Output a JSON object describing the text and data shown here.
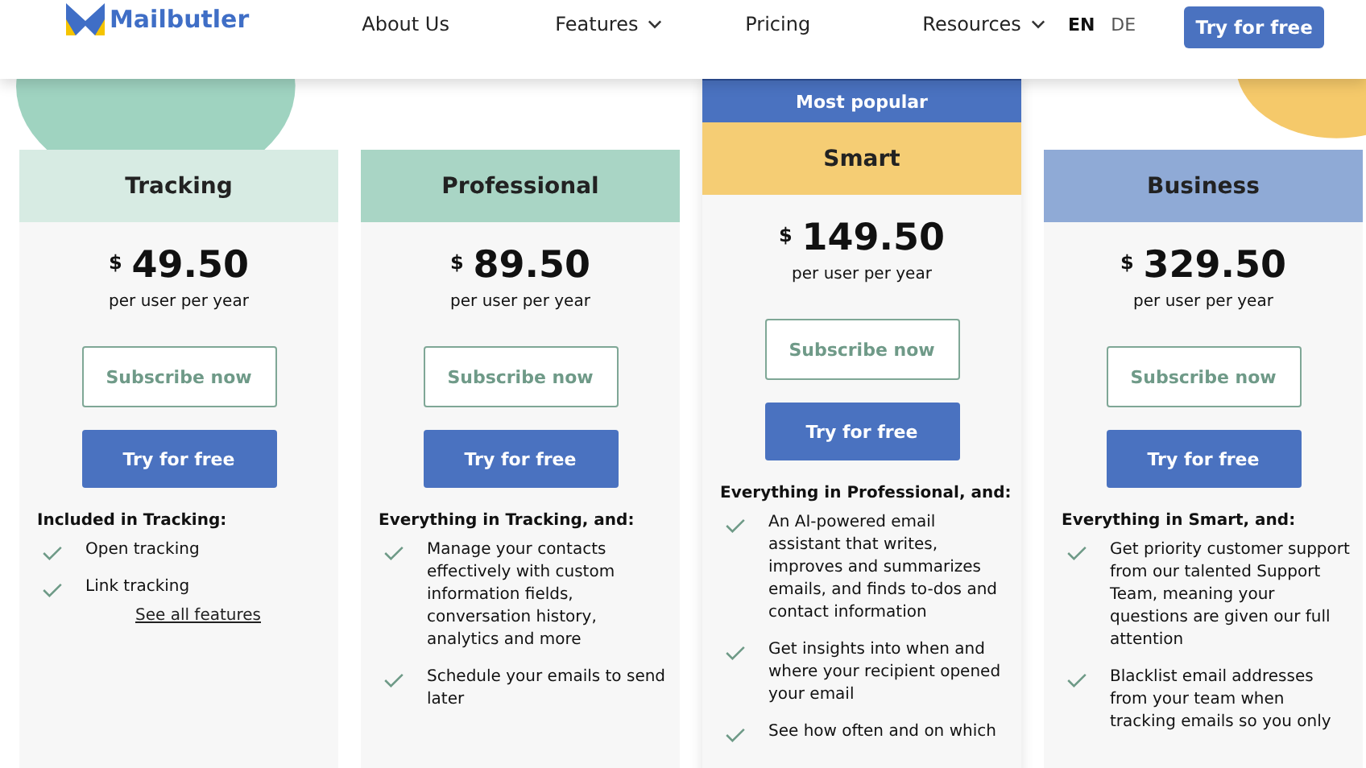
{
  "header": {
    "logo": "Mailbutler",
    "nav": [
      {
        "label": "About Us",
        "dropdown": false
      },
      {
        "label": "Features",
        "dropdown": true
      },
      {
        "label": "Pricing",
        "dropdown": false
      },
      {
        "label": "Resources",
        "dropdown": true
      }
    ],
    "languages": [
      {
        "label": "EN",
        "selected": true
      },
      {
        "label": "DE",
        "selected": false
      }
    ],
    "cta": "Try for free"
  },
  "plans": [
    {
      "name": "Tracking",
      "color": "#d7ebe3",
      "currency": "$",
      "price": "49.50",
      "period": "per user per year",
      "subscribe": "Subscribe now",
      "trial": "Try for free",
      "features_title": "Included in Tracking:",
      "features": [
        "Open tracking",
        "Link tracking"
      ],
      "link": "See all features"
    },
    {
      "name": "Professional",
      "color": "#a9d5c5",
      "currency": "$",
      "price": "89.50",
      "period": "per user per year",
      "subscribe": "Subscribe now",
      "trial": "Try for free",
      "features_title": "Everything in Tracking, and:",
      "features": [
        "Manage your contacts effectively with custom information fields, conversation history, analytics and more",
        "Schedule your emails to send later"
      ]
    },
    {
      "name": "Smart",
      "color": "#f5cd74",
      "badge": "Most popular",
      "currency": "$",
      "price": "149.50",
      "period": "per user per year",
      "subscribe": "Subscribe now",
      "trial": "Try for free",
      "features_title": "Everything in Professional, and:",
      "features": [
        "An AI-powered email assistant that writes, improves and summarizes emails, and finds to-dos and contact information",
        "Get insights into when and where your recipient opened your email",
        "See how often and on which"
      ]
    },
    {
      "name": "Business",
      "color": "#8faad6",
      "currency": "$",
      "price": "329.50",
      "period": "per user per year",
      "subscribe": "Subscribe now",
      "trial": "Try for free",
      "features_title": "Everything in Smart, and:",
      "features": [
        "Get priority customer support from our talented Support Team, meaning your questions are given our full attention",
        "Blacklist email addresses from your team when tracking emails so you only"
      ]
    }
  ]
}
